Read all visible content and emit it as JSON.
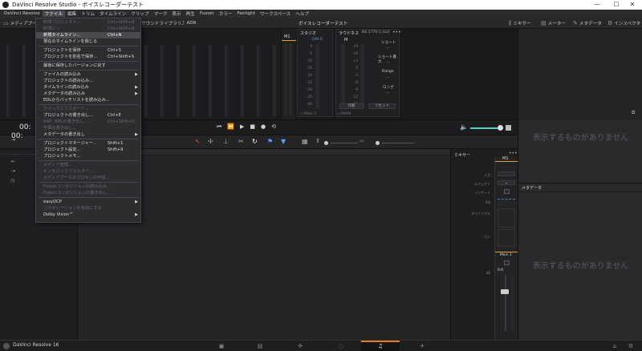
{
  "titlebar": {
    "title": "DaVinci Resolve Studio - ボイスレコーダーテスト",
    "minimize": "—",
    "maximize": "☐",
    "close": "✕"
  },
  "menubar": [
    "DaVinci Resolve",
    "ファイル",
    "編集",
    "トリム",
    "タイムライン",
    "クリップ",
    "マーク",
    "表示",
    "再生",
    "Fusion",
    "カラー",
    "Fairlight",
    "ワークスペース",
    "ヘルプ"
  ],
  "toolbar": {
    "media_pool": "メディアプール",
    "sound_library": "サウンドライブラリ",
    "adr": "ADR",
    "project_title": "ボイスレコーダーテスト",
    "mixer": "ミキサー",
    "meter": "メーター",
    "metadata": "メタデータ",
    "inspector": "インスペクタ"
  },
  "meters": {
    "m1_label": "M1",
    "m1_scale": [
      "0",
      "-5",
      "-10",
      "-15",
      "-20",
      "-25",
      "-30",
      "-35",
      "-40",
      "-45",
      "-50"
    ],
    "studio": {
      "title": "スタジオ",
      "level": "-100.0",
      "scale": [
        "0",
        "-5",
        "-10",
        "-15",
        "-20",
        "-25",
        "-30",
        "-35",
        "-40",
        "-45",
        "-50"
      ],
      "control": "Main 1"
    },
    "loudness": {
      "title": "ラウドネス",
      "standard": "BS.1770-1 (LU)",
      "m_label": "M",
      "dash": "—",
      "scale": [
        "+9",
        "+6",
        "+3",
        "0",
        "-3",
        "-6",
        "-9",
        "-12",
        "-15",
        "-18"
      ],
      "short": "ショート",
      "short_max": "ショート最大",
      "range": "Range",
      "long": "ロング",
      "btn_start": "作動",
      "btn_reset": "リセット",
      "control": "MAIN"
    }
  },
  "transport": {
    "timecode": "00:",
    "buttons": [
      "⏮",
      "⏪",
      "▶",
      "■",
      "●",
      "⟲"
    ]
  },
  "mixer": {
    "title": "ミキサー",
    "labels": [
      "入力",
      "エフェクト",
      "インサート",
      "EQ",
      "ダイナミクス",
      "パン",
      "dB"
    ],
    "channel": "M1",
    "bus": "Main 1",
    "level": "0.0"
  },
  "right_panels": {
    "empty_text": "表示するものがありません",
    "metadata_title": "メタデータ"
  },
  "statusbar": {
    "app": "DaVinci Resolve 16"
  },
  "dropdown": {
    "items": [
      {
        "label": "新規プロジェクト...",
        "shortcut": "Ctrl+Shift+N",
        "disabled": true
      },
      {
        "label": "新規ビン",
        "shortcut": "Ctrl+Shift+N",
        "disabled": true
      },
      {
        "label": "新規タイムライン...",
        "shortcut": "Ctrl+N",
        "disabled": false,
        "highlight": true
      },
      {
        "label": "現在のタイムラインを閉じる",
        "shortcut": "",
        "disabled": false
      },
      {
        "label": "プロジェクトを保存",
        "shortcut": "Ctrl+S",
        "disabled": false
      },
      {
        "label": "プロジェクトを別名で保存...",
        "shortcut": "Ctrl+Shift+S",
        "disabled": false
      },
      {
        "label": "最後に保存したバージョンに戻す",
        "shortcut": "",
        "disabled": false
      },
      {
        "label": "ファイルの読み込み",
        "shortcut": "",
        "disabled": false,
        "submenu": true
      },
      {
        "label": "プロジェクトの読み込み...",
        "shortcut": "",
        "disabled": false
      },
      {
        "label": "タイムラインの読み込み",
        "shortcut": "",
        "disabled": false,
        "submenu": true
      },
      {
        "label": "メタデータの読み込み",
        "shortcut": "",
        "disabled": false,
        "submenu": true
      },
      {
        "label": "EDLからパッチリストを読み込み...",
        "shortcut": "",
        "disabled": false
      },
      {
        "label": "クイックエクスポート...",
        "shortcut": "",
        "disabled": true
      },
      {
        "label": "プロジェクトの書き出し...",
        "shortcut": "Ctrl+E",
        "disabled": false
      },
      {
        "label": "AAF, XMLの書き出し...",
        "shortcut": "Ctrl+Shift+O",
        "disabled": true
      },
      {
        "label": "字幕の書き出し...",
        "shortcut": "",
        "disabled": true
      },
      {
        "label": "メタデータの書き出し",
        "shortcut": "",
        "disabled": false,
        "submenu": true
      },
      {
        "label": "プロジェクトマネージャー...",
        "shortcut": "Shift+1",
        "disabled": false
      },
      {
        "label": "プロジェクト設定...",
        "shortcut": "Shift+9",
        "disabled": false
      },
      {
        "label": "プロジェクトメモ...",
        "shortcut": "",
        "disabled": false
      },
      {
        "label": "メディア管理...",
        "shortcut": "",
        "disabled": true
      },
      {
        "label": "ビンをロックフォルダー...",
        "shortcut": "",
        "disabled": true
      },
      {
        "label": "メディアプールのプロキシの作成...",
        "shortcut": "",
        "disabled": true
      },
      {
        "label": "Fusionコンポジションの読み込み...",
        "shortcut": "",
        "disabled": true
      },
      {
        "label": "Fusionコンポジションの書き出し...",
        "shortcut": "",
        "disabled": true
      },
      {
        "label": "easyDCP",
        "shortcut": "",
        "disabled": false,
        "submenu": true
      },
      {
        "label": "コラボレーションを有効にする",
        "shortcut": "",
        "disabled": true
      },
      {
        "label": "Dolby Vision™",
        "shortcut": "",
        "disabled": false,
        "submenu": true
      }
    ]
  }
}
